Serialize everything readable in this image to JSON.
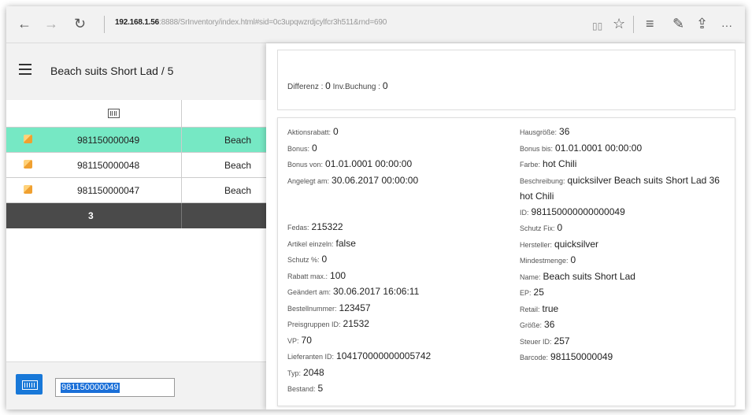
{
  "browser": {
    "back": "←",
    "forward": "→",
    "refresh": "↻",
    "url_host": "192.168.1.56",
    "url_path": ":8888/SrInventory/index.html#sid=0c3upqwzrdjcylfcr3h511&rnd=690",
    "reader": "▯▯",
    "favorite": "☆",
    "hub": "≡",
    "notes": "✎",
    "share": "⇪",
    "more": "···"
  },
  "app": {
    "title": "Beach suits Short Lad / 5"
  },
  "grid": {
    "rows": [
      {
        "number": "981150000049",
        "text": "Beach",
        "selected": true
      },
      {
        "number": "981150000048",
        "text": "Beach",
        "selected": false
      },
      {
        "number": "981150000047",
        "text": "Beach",
        "selected": false
      }
    ],
    "footer_count": "3"
  },
  "scan": {
    "value": "981150000049"
  },
  "dialog": {
    "close": "×",
    "difference_label": "Differenz : ",
    "difference_value": "0",
    "inv_label": " Inv.Buchung : ",
    "inv_value": "0",
    "left": [
      {
        "k": "Aktionsrabatt:",
        "v": "0"
      },
      {
        "k": "Bonus:",
        "v": "0"
      },
      {
        "k": "Bonus von:",
        "v": "01.01.0001 00:00:00"
      },
      {
        "k": "Angelegt am:",
        "v": "30.06.2017 00:00:00"
      },
      {
        "k": "",
        "v": ""
      },
      {
        "k": "Fedas:",
        "v": "215322"
      },
      {
        "k": "Artikel einzeln:",
        "v": "false"
      },
      {
        "k": "Schutz %:",
        "v": "0"
      },
      {
        "k": "Rabatt max.:",
        "v": "100"
      },
      {
        "k": "Geändert am:",
        "v": "30.06.2017 16:06:11"
      },
      {
        "k": "Bestellnummer:",
        "v": "123457"
      },
      {
        "k": "Preisgruppen ID:",
        "v": "21532"
      },
      {
        "k": "VP:",
        "v": "70"
      },
      {
        "k": "Lieferanten ID:",
        "v": "104170000000005742"
      },
      {
        "k": "Typ:",
        "v": "2048"
      },
      {
        "k": "Bestand:",
        "v": "5"
      }
    ],
    "right": [
      {
        "k": "Hausgröße:",
        "v": "36"
      },
      {
        "k": "Bonus bis:",
        "v": "01.01.0001 00:00:00"
      },
      {
        "k": "Farbe:",
        "v": "hot Chili"
      },
      {
        "k": "Beschreibung:",
        "v": "quicksilver Beach suits Short Lad 36 hot Chili"
      },
      {
        "k": "ID:",
        "v": "981150000000000049"
      },
      {
        "k": "Schutz Fix:",
        "v": "0"
      },
      {
        "k": "Hersteller:",
        "v": "quicksilver"
      },
      {
        "k": "Mindestmenge:",
        "v": "0"
      },
      {
        "k": "Name:",
        "v": "Beach suits Short Lad"
      },
      {
        "k": "EP:",
        "v": "25"
      },
      {
        "k": "Retail:",
        "v": "true"
      },
      {
        "k": "Größe:",
        "v": "36"
      },
      {
        "k": "Steuer ID:",
        "v": "257"
      },
      {
        "k": "Barcode:",
        "v": "981150000049"
      }
    ]
  }
}
